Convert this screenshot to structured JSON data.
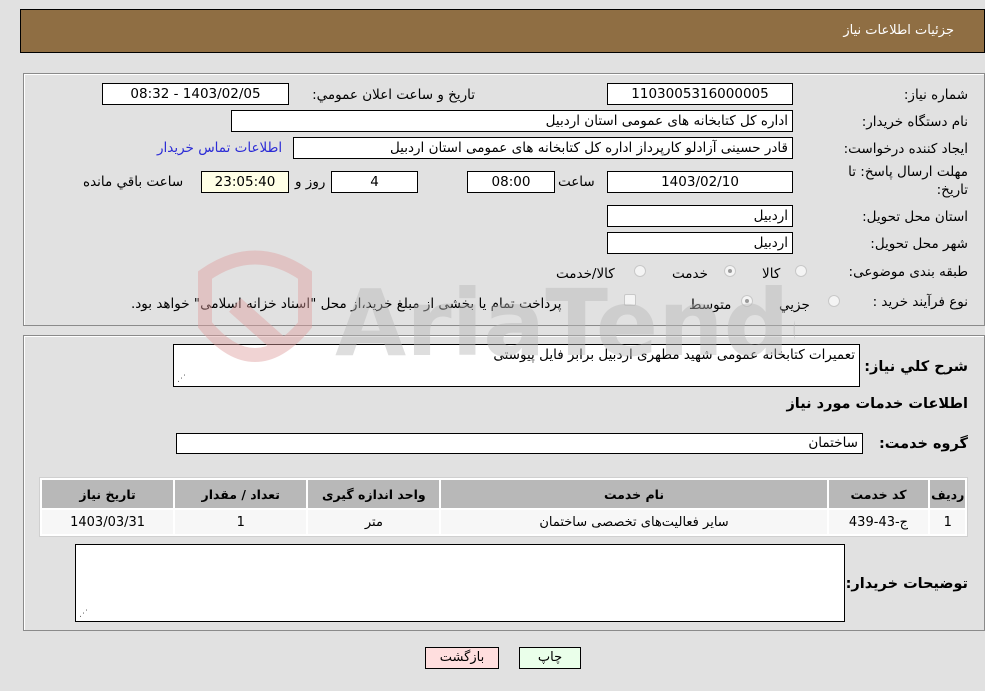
{
  "header": {
    "title": "جزئیات اطلاعات نیاز"
  },
  "form": {
    "need_number": {
      "label": "شماره نیاز:",
      "value": "1103005316000005"
    },
    "announce_datetime": {
      "label": "تاریخ و ساعت اعلان عمومي:",
      "value": "1403/02/05 - 08:32"
    },
    "buyer_org": {
      "label": "نام دستگاه خریدار:",
      "value": "اداره کل کتابخانه های عمومی استان اردبیل"
    },
    "requester": {
      "label": "ایجاد کننده درخواست:",
      "value": "قادر حسینی آزادلو کارپرداز اداره کل کتابخانه های عمومی استان اردبیل"
    },
    "buyer_contact_link": "اطلاعات تماس خریدار",
    "deadline": {
      "label_line1": "مهلت ارسال پاسخ: تا",
      "label_line2": "تاریخ:",
      "date": "1403/02/10",
      "time_label": "ساعت",
      "time": "08:00",
      "days": "4",
      "days_label": "روز و",
      "remaining": "23:05:40",
      "remaining_label": "ساعت باقي مانده"
    },
    "delivery_province": {
      "label": "استان محل تحویل:",
      "value": "اردبیل"
    },
    "delivery_city": {
      "label": "شهر محل تحویل:",
      "value": "اردبیل"
    },
    "category": {
      "label": "طبقه بندی موضوعی:",
      "options": [
        {
          "label": "کالا",
          "selected": false
        },
        {
          "label": "خدمت",
          "selected": true
        },
        {
          "label": "کالا/خدمت",
          "selected": false
        }
      ]
    },
    "purchase_process": {
      "label": "نوع فرآیند خرید :",
      "options": [
        {
          "label": "جزيي",
          "selected": false
        },
        {
          "label": "متوسط",
          "selected": true
        }
      ],
      "treasury_checkbox": {
        "label": "پرداخت تمام یا بخشی از مبلغ خرید،از محل \"اسناد خزانه اسلامی\" خواهد بود.",
        "checked": false
      }
    }
  },
  "details": {
    "description": {
      "label": "شرح کلي نياز:",
      "value": "تعمیرات کتابخانه عمومی شهید مطهری اردبیل برابر فایل پیوستی"
    },
    "services_heading": "اطلاعات خدمات مورد نياز",
    "service_group": {
      "label": "گروه خدمت:",
      "value": "ساختمان"
    },
    "table": {
      "columns": [
        "ردیف",
        "کد خدمت",
        "نام خدمت",
        "واحد اندازه گیری",
        "تعداد / مقدار",
        "تاریخ نیاز"
      ],
      "rows": [
        [
          "1",
          "ج-43-439",
          "سایر فعالیت‌های تخصصی ساختمان",
          "متر",
          "1",
          "1403/03/31"
        ]
      ]
    },
    "buyer_notes": {
      "label": "توضیحات خریدار:",
      "value": ""
    }
  },
  "buttons": {
    "print": "چاپ",
    "back": "بازگشت"
  },
  "watermark": {
    "text": "AriaTender.neT"
  },
  "colors": {
    "header_bg": "#8f6e43",
    "link": "#2b2bd6",
    "back_button": "#ffdede",
    "print_button": "#eaffea",
    "remaining_bg": "#ffffe6"
  }
}
